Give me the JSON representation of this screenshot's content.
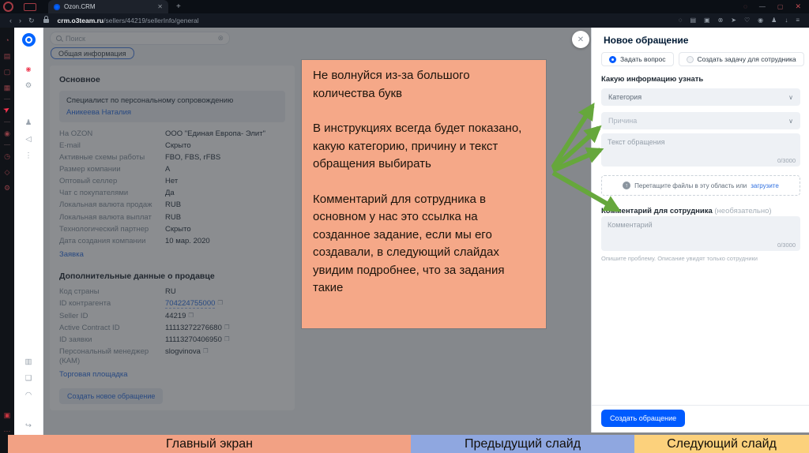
{
  "browser": {
    "tab_title": "Ozon.CRM",
    "url_host": "crm.o3team.ru",
    "url_path": "/sellers/44219/sellerInfo/general",
    "ext_icons": [
      {
        "name": "search-icon",
        "glyph": "◌"
      },
      {
        "name": "kanban-icon",
        "glyph": "▤"
      },
      {
        "name": "camera-icon",
        "glyph": "▣"
      },
      {
        "name": "blocker-icon",
        "glyph": "⊗"
      },
      {
        "name": "share-icon",
        "glyph": "➤"
      },
      {
        "name": "favorites-icon",
        "glyph": "♡"
      },
      {
        "name": "extension-icon",
        "glyph": "◉"
      },
      {
        "name": "profile-icon",
        "glyph": "♟"
      },
      {
        "name": "download-icon",
        "glyph": "↓"
      },
      {
        "name": "menu-icon",
        "glyph": "≡"
      }
    ]
  },
  "icons": {
    "back": "‹",
    "forward": "›",
    "reload": "↻",
    "tab_close": "✕",
    "new_tab": "+",
    "win_search": "◌",
    "win_min": "—",
    "win_restore": "▢",
    "win_close": "✕",
    "clear": "⊗",
    "copy": "❐",
    "chevron": "∨",
    "close": "✕",
    "upload_arrow": "↑"
  },
  "rail_dark": [
    {
      "name": "history-icon",
      "glyph": "◔"
    },
    {
      "name": "apps-icon",
      "glyph": "▤"
    },
    {
      "name": "chat-icon",
      "glyph": "▢"
    },
    {
      "name": "grid-icon",
      "glyph": "▦"
    },
    {
      "name": "divider",
      "glyph": "",
      "cls": "divider"
    },
    {
      "name": "pointer-icon",
      "glyph": "➤",
      "cls": "active"
    },
    {
      "name": "divider",
      "glyph": "",
      "cls": "divider"
    },
    {
      "name": "play-icon",
      "glyph": "◉"
    },
    {
      "name": "divider",
      "glyph": "",
      "cls": "divider"
    },
    {
      "name": "clock-icon",
      "glyph": "◷"
    },
    {
      "name": "cube-icon",
      "glyph": "◇"
    },
    {
      "name": "gear-icon",
      "glyph": "⚙"
    }
  ],
  "rail_dark_bottom": [
    {
      "name": "record-camera-icon",
      "glyph": "▣",
      "cls": "bright"
    },
    {
      "name": "more-icon",
      "glyph": "⋯"
    }
  ],
  "rail_crm": [
    {
      "name": "record-icon",
      "glyph": "◉",
      "cls": "red"
    },
    {
      "name": "gear-icon",
      "glyph": "⚙"
    },
    {
      "name": "spacer",
      "glyph": "",
      "cls": "sp"
    },
    {
      "name": "user-icon",
      "glyph": "♟"
    },
    {
      "name": "megaphone-icon",
      "glyph": "◁"
    },
    {
      "name": "more-icon",
      "glyph": "⋮"
    }
  ],
  "rail_crm_bottom": [
    {
      "name": "image-icon",
      "glyph": "▥"
    },
    {
      "name": "chat-icon",
      "glyph": "❑"
    },
    {
      "name": "bell-icon",
      "glyph": "◠"
    },
    {
      "name": "logout-icon",
      "glyph": "↪",
      "cls": "exit"
    }
  ],
  "crm": {
    "search_placeholder": "Поиск",
    "tab_general": "Общая информация",
    "section_main_title": "Основное",
    "specialist_label": "Специалист по персональному сопровождению",
    "specialist_name": "Аникеева Наталия",
    "rows": [
      {
        "label": "На OZON",
        "value": "ООО \"Единая Европа- Элит\""
      },
      {
        "label": "E-mail",
        "value": "Скрыто"
      },
      {
        "label": "Активные схемы работы",
        "value": "FBO, FBS, rFBS"
      },
      {
        "label": "Размер компании",
        "value": "A"
      },
      {
        "label": "Оптовый селлер",
        "value": "Нет"
      },
      {
        "label": "Чат с покупателями",
        "value": "Да"
      },
      {
        "label": "Локальная валюта продаж",
        "value": "RUB"
      },
      {
        "label": "Локальная валюта выплат",
        "value": "RUB"
      },
      {
        "label": "Технологический партнер",
        "value": "Скрыто"
      },
      {
        "label": "Дата создания компании",
        "value": "10 мар. 2020"
      }
    ],
    "request_link": "Заявка",
    "section_additional_title": "Дополнительные данные о продавце",
    "additional_rows": [
      {
        "label": "Код страны",
        "value": "RU"
      },
      {
        "label": "ID контрагента",
        "value": "704224755000",
        "link": true,
        "copy": true
      },
      {
        "label": "Seller ID",
        "value": "44219",
        "copy": true
      },
      {
        "label": "Active Contract ID",
        "value": "11113272276680",
        "copy": true
      },
      {
        "label": "ID заявки",
        "value": "11113270406950",
        "copy": true
      },
      {
        "label": "Персональный менеджер (КАМ)",
        "value": "slogvinova",
        "copy": true
      }
    ],
    "marketplace_link": "Торговая площадка",
    "new_request_button": "Создать новое обращение"
  },
  "drawer": {
    "title": "Новое обращение",
    "radio_ask": "Задать вопрос",
    "radio_task": "Создать задачу для сотрудника",
    "info_label": "Какую информацию узнать",
    "category_placeholder": "Категория",
    "reason_placeholder": "Причина",
    "text_placeholder": "Текст обращения",
    "text_counter": "0/3000",
    "upload_text": "Перетащите файлы в эту область или",
    "upload_link": "загрузите",
    "comment_label": "Комментарий для сотрудника",
    "comment_optional": "(необязательно)",
    "comment_placeholder": "Комментарий",
    "comment_counter": "0/3000",
    "helper": "Опишите проблему. Описание увидят только сотрудники",
    "submit": "Создать обращение"
  },
  "annotation": {
    "p1": "Не волнуйся из-за большого количества букв",
    "p2": "В инструкциях всегда будет показано, какую категорию, причину и текст обращения выбирать",
    "p3": "Комментарий для сотрудника в основном у нас это ссылка на созданное задание, если мы его создавали, в следующий слайдах увидим подробнее, что за задания такие"
  },
  "bottom_bar": {
    "home": "Главный экран",
    "prev": "Предыдущий слайд",
    "next": "Следующий слайд",
    "colors": {
      "home": "#f2a184",
      "prev": "#8fa7e0",
      "next": "#fcd17c"
    }
  },
  "colors": {
    "accent_blue": "#005bff",
    "arrow_green": "#66a73c",
    "annotation_bg": "#f5a888"
  }
}
